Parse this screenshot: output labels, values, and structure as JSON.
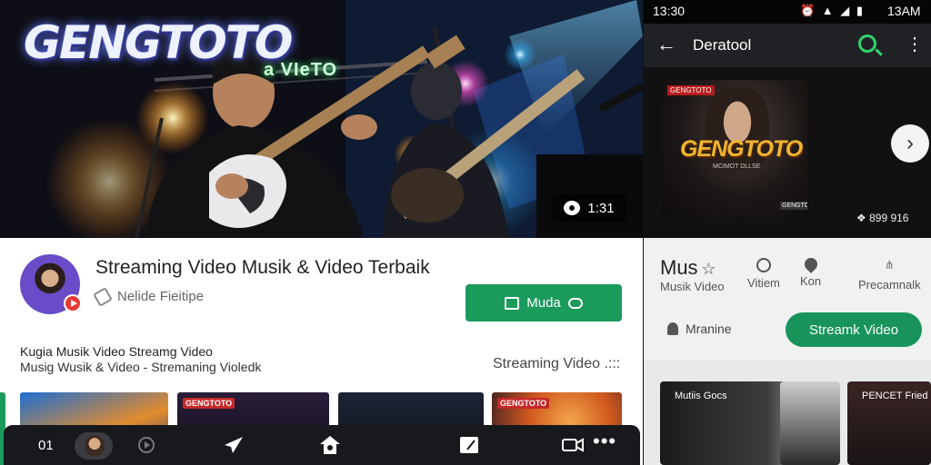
{
  "left": {
    "hero": {
      "brand_logo": "GENGTOTO",
      "stage_sign": "a VIeTO",
      "view_count": "1:31"
    },
    "channel": {
      "video_title": "Streaming Video Musik & Video Terbaik",
      "channel_name": "Nelide Fieitipe",
      "subscribe_label": "Muda"
    },
    "description": {
      "line1": "Kugia Musik Video  Streamg Video",
      "line2": "Musig Wusik & Video - Stremaning Violedk",
      "right_text": "Streaming Video .:::"
    },
    "thumbnails": [
      {
        "tag": ""
      },
      {
        "tag": "GENGTOTO"
      },
      {
        "tag": ""
      },
      {
        "tag": "GENGTOTO"
      }
    ],
    "bottom_nav": {
      "count": "01",
      "more": "•••"
    }
  },
  "right": {
    "status_bar": {
      "time_left": "13:30",
      "icons": "⏰ ▲ ◢ ▮",
      "time_right": "13AM"
    },
    "app_bar": {
      "title": "Deratool",
      "back": "←",
      "menu": "⋮"
    },
    "feature": {
      "tag": "GENGTOTO",
      "title": "GENGTOTO",
      "subtitle": "MCIMOT DLLSE",
      "corner": "GENGTOTO",
      "count": "❖ 899 916"
    },
    "categories": {
      "mus_label": "Mus",
      "mus_sub": "Musik  Video",
      "vitem": "Vitiem",
      "kon": "Kon",
      "pres": "Precamnalk"
    },
    "presenter_label": "Mranine",
    "stream_button": "Streamk Video",
    "bottom_thumbs": [
      {
        "label": "Mutiis Gocs"
      },
      {
        "label": ""
      },
      {
        "label": "PENCET Fried"
      }
    ],
    "next_icon": "›"
  },
  "colors": {
    "accent_green": "#1a9a5b",
    "search_green": "#2fd36a",
    "logo_gold": "#f0b431"
  }
}
